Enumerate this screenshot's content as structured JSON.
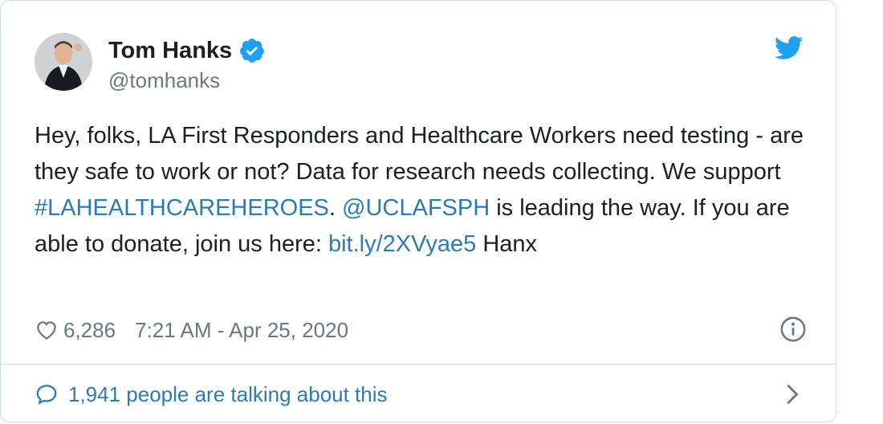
{
  "author": {
    "name": "Tom Hanks",
    "handle": "@tomhanks"
  },
  "tweet": {
    "text_part1": "Hey, folks, LA First Responders and Healthcare Workers need testing - are they safe to work or not? Data for research needs collecting. We support ",
    "hashtag": "#LAHEALTHCAREHEROES",
    "text_part2": ". ",
    "mention": "@UCLAFSPH",
    "text_part3": " is leading the way. If you are able to donate, join us here: ",
    "url": "bit.ly/2XVyae5",
    "text_part4": " Hanx"
  },
  "meta": {
    "likes": "6,286",
    "timestamp": "7:21 AM - Apr 25, 2020"
  },
  "footer": {
    "talking": "1,941 people are talking about this"
  },
  "colors": {
    "link": "#2b7bb9",
    "muted": "#697882",
    "verified": "#1da1f2",
    "twitter": "#1da1f2"
  },
  "icons": [
    "twitter-bird-icon",
    "verified-badge-icon",
    "heart-icon",
    "info-icon",
    "comment-bubble-icon",
    "chevron-right-icon"
  ]
}
